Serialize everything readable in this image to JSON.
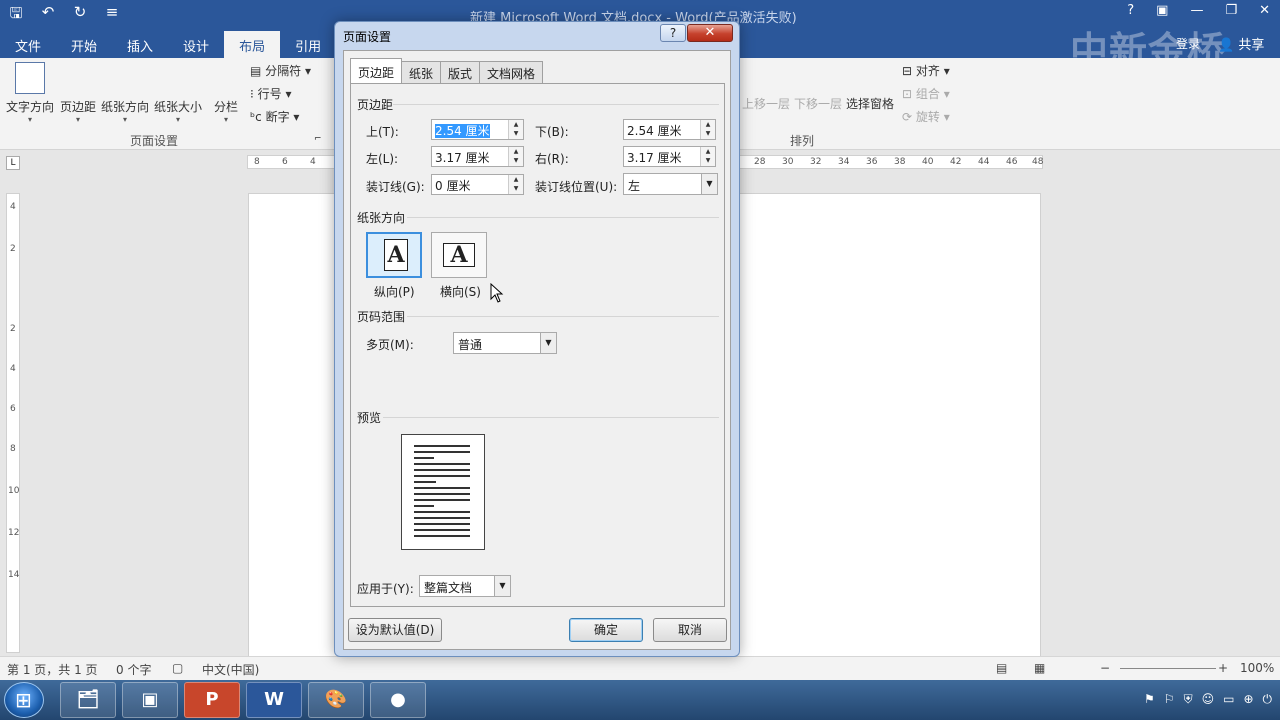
{
  "window": {
    "title": "新建 Microsoft Word 文档.docx - Word(产品激活失败)",
    "tabs": [
      "文件",
      "开始",
      "插入",
      "设计",
      "布局",
      "引用"
    ],
    "active_tab": "布局",
    "login": "登录",
    "share": "共享",
    "watermark": "中新金桥"
  },
  "ribbon": {
    "page_setup_buttons": [
      "文字方向",
      "页边距",
      "纸张方向",
      "纸张大小",
      "分栏"
    ],
    "small_buttons": [
      "分隔符",
      "行号",
      "断字"
    ],
    "page_setup_label": "页面设置",
    "arrange_buttons": [
      "上移一层",
      "下移一层",
      "选择窗格"
    ],
    "arrange_small": [
      "对齐",
      "组合",
      "旋转"
    ],
    "arrange_label": "排列"
  },
  "ruler": {
    "left_ticks": [
      "8",
      "6",
      "4"
    ],
    "right_ticks": [
      "28",
      "30",
      "32",
      "34",
      "36",
      "38",
      "40",
      "42",
      "44",
      "46",
      "48"
    ],
    "vertical_ticks": [
      "4",
      "2",
      "2",
      "4",
      "6",
      "8",
      "10",
      "12",
      "14"
    ],
    "tab_marker": "L"
  },
  "dialog": {
    "title": "页面设置",
    "help": "?",
    "close": "✕",
    "tabs": [
      "页边距",
      "纸张",
      "版式",
      "文档网格"
    ],
    "active_tab": "页边距",
    "margins_section": "页边距",
    "top_label": "上(T):",
    "top_value": "2.54 厘米",
    "bottom_label": "下(B):",
    "bottom_value": "2.54 厘米",
    "left_label": "左(L):",
    "left_value": "3.17 厘米",
    "right_label": "右(R):",
    "right_value": "3.17 厘米",
    "gutter_label": "装订线(G):",
    "gutter_value": "0 厘米",
    "gutter_pos_label": "装订线位置(U):",
    "gutter_pos_value": "左",
    "orientation_section": "纸张方向",
    "portrait": "纵向(P)",
    "landscape": "横向(S)",
    "orientation_glyph": "A",
    "pages_section": "页码范围",
    "multiple_pages_label": "多页(M):",
    "multiple_pages_value": "普通",
    "preview_section": "预览",
    "apply_to_label": "应用于(Y):",
    "apply_to_value": "整篇文档",
    "set_default": "设为默认值(D)",
    "ok": "确定",
    "cancel": "取消"
  },
  "status": {
    "page": "第 1 页，共 1 页",
    "words": "0 个字",
    "language": "中文(中国)",
    "zoom": "100%"
  },
  "taskbar": {
    "apps": [
      "explorer",
      "media",
      "P",
      "W",
      "paint",
      "recorder"
    ],
    "tray_time": "",
    "colors": {
      "bar": "#2b579a"
    }
  }
}
